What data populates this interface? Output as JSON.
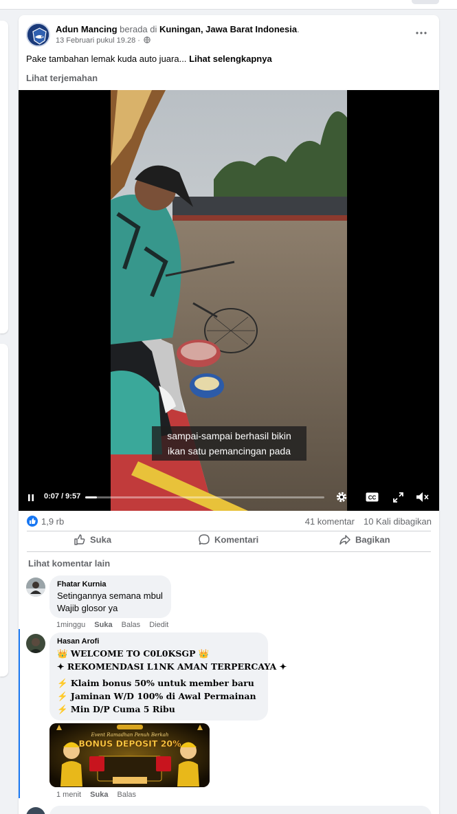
{
  "post": {
    "author": "Adun Mancing",
    "location_prefix": "berada di",
    "location": "Kuningan, Jawa Barat Indonesia",
    "location_suffix": ".",
    "date": "13 Februari pukul 19.28 ·",
    "text": "Pake tambahan lemak kuda auto juara...",
    "see_more": "Lihat selengkapnya",
    "translate": "Lihat terjemahan",
    "more_icon": "more-horizontal-icon",
    "privacy_icon": "globe-icon"
  },
  "video": {
    "caption_line1": "sampai-sampai berhasil bikin",
    "caption_line2": "ikan satu pemancingan pada",
    "time": "0:07 / 9:57",
    "progress": 0.05
  },
  "stats": {
    "likes": "1,9 rb",
    "comments": "41 komentar",
    "shares": "10 Kali dibagikan"
  },
  "actions": {
    "like": "Suka",
    "comment": "Komentari",
    "share": "Bagikan"
  },
  "comments_section": {
    "view_more": "Lihat komentar lain",
    "comments": [
      {
        "name": "Fhatar Kurnia",
        "lines": [
          "Setingannya semana mbul",
          "Wajib glosor ya"
        ],
        "time": "1minggu",
        "like": "Suka",
        "reply": "Balas",
        "edited": "Diedit"
      },
      {
        "name": "Hasan Arofi",
        "lines": [
          "👑 WELCOME TO C0L0KSGP 👑",
          "✦ REKOMENDASI L1NK AMAN TERPERCAYA ✦",
          "⚡ Klaim bonus 50% untuk member baru",
          "⚡ Jaminan W/D 100% di Awal Permainan",
          "⚡ Min D/P Cuma 5 Ribu"
        ],
        "image_top": "Event Ramadhan Penuh Berkah",
        "image_title": "BONUS DEPOSIT 20%",
        "time": "1 menit",
        "like": "Suka",
        "reply": "Balas"
      }
    ]
  },
  "colors": {
    "accent": "#1877f2",
    "secondary_text": "#65676b",
    "bubble": "#f0f2f5"
  }
}
